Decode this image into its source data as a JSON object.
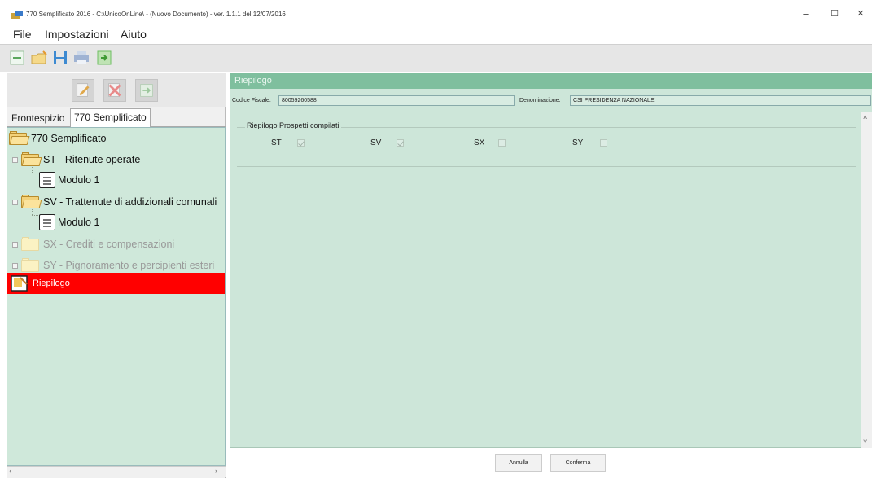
{
  "window": {
    "title": "770 Semplificato 2016 - C:\\UnicoOnLine\\ - (Nuovo Documento) - ver. 1.1.1 del 12/07/2016",
    "minimize": "–",
    "maximize": "☐",
    "close": "✕"
  },
  "menu": {
    "items": [
      "File",
      "Impostazioni",
      "Aiuto"
    ]
  },
  "toolbar": {
    "icons": [
      "new-document-icon",
      "open-folder-icon",
      "save-icon",
      "print-icon",
      "export-icon"
    ]
  },
  "left_panel": {
    "action_icons": [
      "edit-icon",
      "delete-icon",
      "refresh-icon"
    ],
    "tabs": [
      {
        "label": "Frontespizio",
        "active": false
      },
      {
        "label": "770 Semplificato",
        "active": true
      }
    ],
    "tree": {
      "root": "770 Semplificato",
      "nodes": [
        {
          "label": "ST - Ritenute operate",
          "enabled": true,
          "child": "Modulo 1"
        },
        {
          "label": "SV - Trattenute di addizionali comunali",
          "enabled": true,
          "child": "Modulo 1"
        },
        {
          "label": "SX - Crediti e compensazioni",
          "enabled": false
        },
        {
          "label": "SY - Pignoramento e percipienti esteri",
          "enabled": false
        },
        {
          "label": "Riepilogo",
          "enabled": true,
          "selected": true
        }
      ]
    }
  },
  "right_panel": {
    "header": "Riepilogo",
    "codice_fiscale_label": "Codice Fiscale:",
    "codice_fiscale_value": "80059260588",
    "denominazione_label": "Denominazione:",
    "denominazione_value": "CSI PRESIDENZA NAZIONALE",
    "group_title": "Riepilogo Prospetti compilati",
    "checks": [
      {
        "label": "ST",
        "checked": true
      },
      {
        "label": "SV",
        "checked": true
      },
      {
        "label": "SX",
        "checked": false
      },
      {
        "label": "SY",
        "checked": false
      }
    ],
    "buttons": {
      "cancel": "Annulla",
      "confirm": "Conferma"
    }
  },
  "colors": {
    "panel_green": "#cde6d9",
    "header_green": "#7fbf9e",
    "selected_red": "#ff0000"
  }
}
